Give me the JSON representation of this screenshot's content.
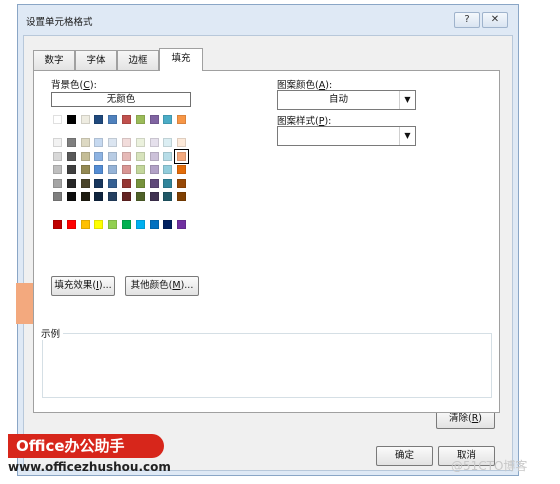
{
  "dialog": {
    "title": "设置单元格格式",
    "help_glyph": "?",
    "close_glyph": "✕"
  },
  "tabs": [
    "数字",
    "字体",
    "边框",
    "填充"
  ],
  "fill": {
    "bg_color_label": "背景色",
    "bg_color_key": "C",
    "no_color_label": "无颜色",
    "pattern_color_label": "图案颜色",
    "pattern_color_key": "A",
    "pattern_color_value": "自动",
    "pattern_style_label": "图案样式",
    "pattern_style_key": "P",
    "pattern_style_value": "",
    "fill_effects_label": "填充效果(",
    "fill_effects_key": "I",
    "fill_effects_suffix": ")...",
    "more_colors_label": "其他颜色(",
    "more_colors_key": "M",
    "more_colors_suffix": ")...",
    "selected_color": "#f3a97e",
    "palette_top": [
      "#ffffff",
      "#000000",
      "#eeece1",
      "#1f497d",
      "#4f81bd",
      "#c0504d",
      "#9bbb59",
      "#8064a2",
      "#4bacc6",
      "#f79646"
    ],
    "palette_shades": [
      [
        "#f2f2f2",
        "#7f7f7f",
        "#ddd9c3",
        "#c6d9f0",
        "#dbe5f1",
        "#f2dcdb",
        "#ebf1dd",
        "#e5e0ec",
        "#dbeef3",
        "#fdeada"
      ],
      [
        "#d8d8d8",
        "#595959",
        "#c4bd97",
        "#8db3e2",
        "#b8cce4",
        "#e5b9b7",
        "#d7e3bc",
        "#ccc1d9",
        "#b7dde8",
        "#f3a97e"
      ],
      [
        "#bfbfbf",
        "#3f3f3f",
        "#938953",
        "#548dd4",
        "#95b3d7",
        "#d99694",
        "#c3d69b",
        "#b2a2c7",
        "#92cddc",
        "#e36c09"
      ],
      [
        "#a5a5a5",
        "#262626",
        "#494429",
        "#17365d",
        "#366092",
        "#953734",
        "#76923c",
        "#5f497a",
        "#31859b",
        "#974806"
      ],
      [
        "#7f7f7f",
        "#0c0c0c",
        "#1d1b10",
        "#0f243e",
        "#244061",
        "#632423",
        "#4f6128",
        "#3f3151",
        "#205867",
        "#7f3f02"
      ]
    ],
    "palette_standard": [
      "#c00000",
      "#ff0000",
      "#ffc000",
      "#ffff00",
      "#92d050",
      "#00b050",
      "#00b0f0",
      "#0070c0",
      "#002060",
      "#7030a0"
    ]
  },
  "sample": {
    "label": "示例",
    "color": "#f3a97e"
  },
  "buttons": {
    "clear_label": "清除(",
    "clear_key": "R",
    "clear_suffix": ")",
    "ok_label": "确定",
    "cancel_label": "取消"
  },
  "overlay": {
    "logo_text": "Office办公助手",
    "url": "www.officezhushou.com",
    "watermark": "@51CTO博客"
  }
}
